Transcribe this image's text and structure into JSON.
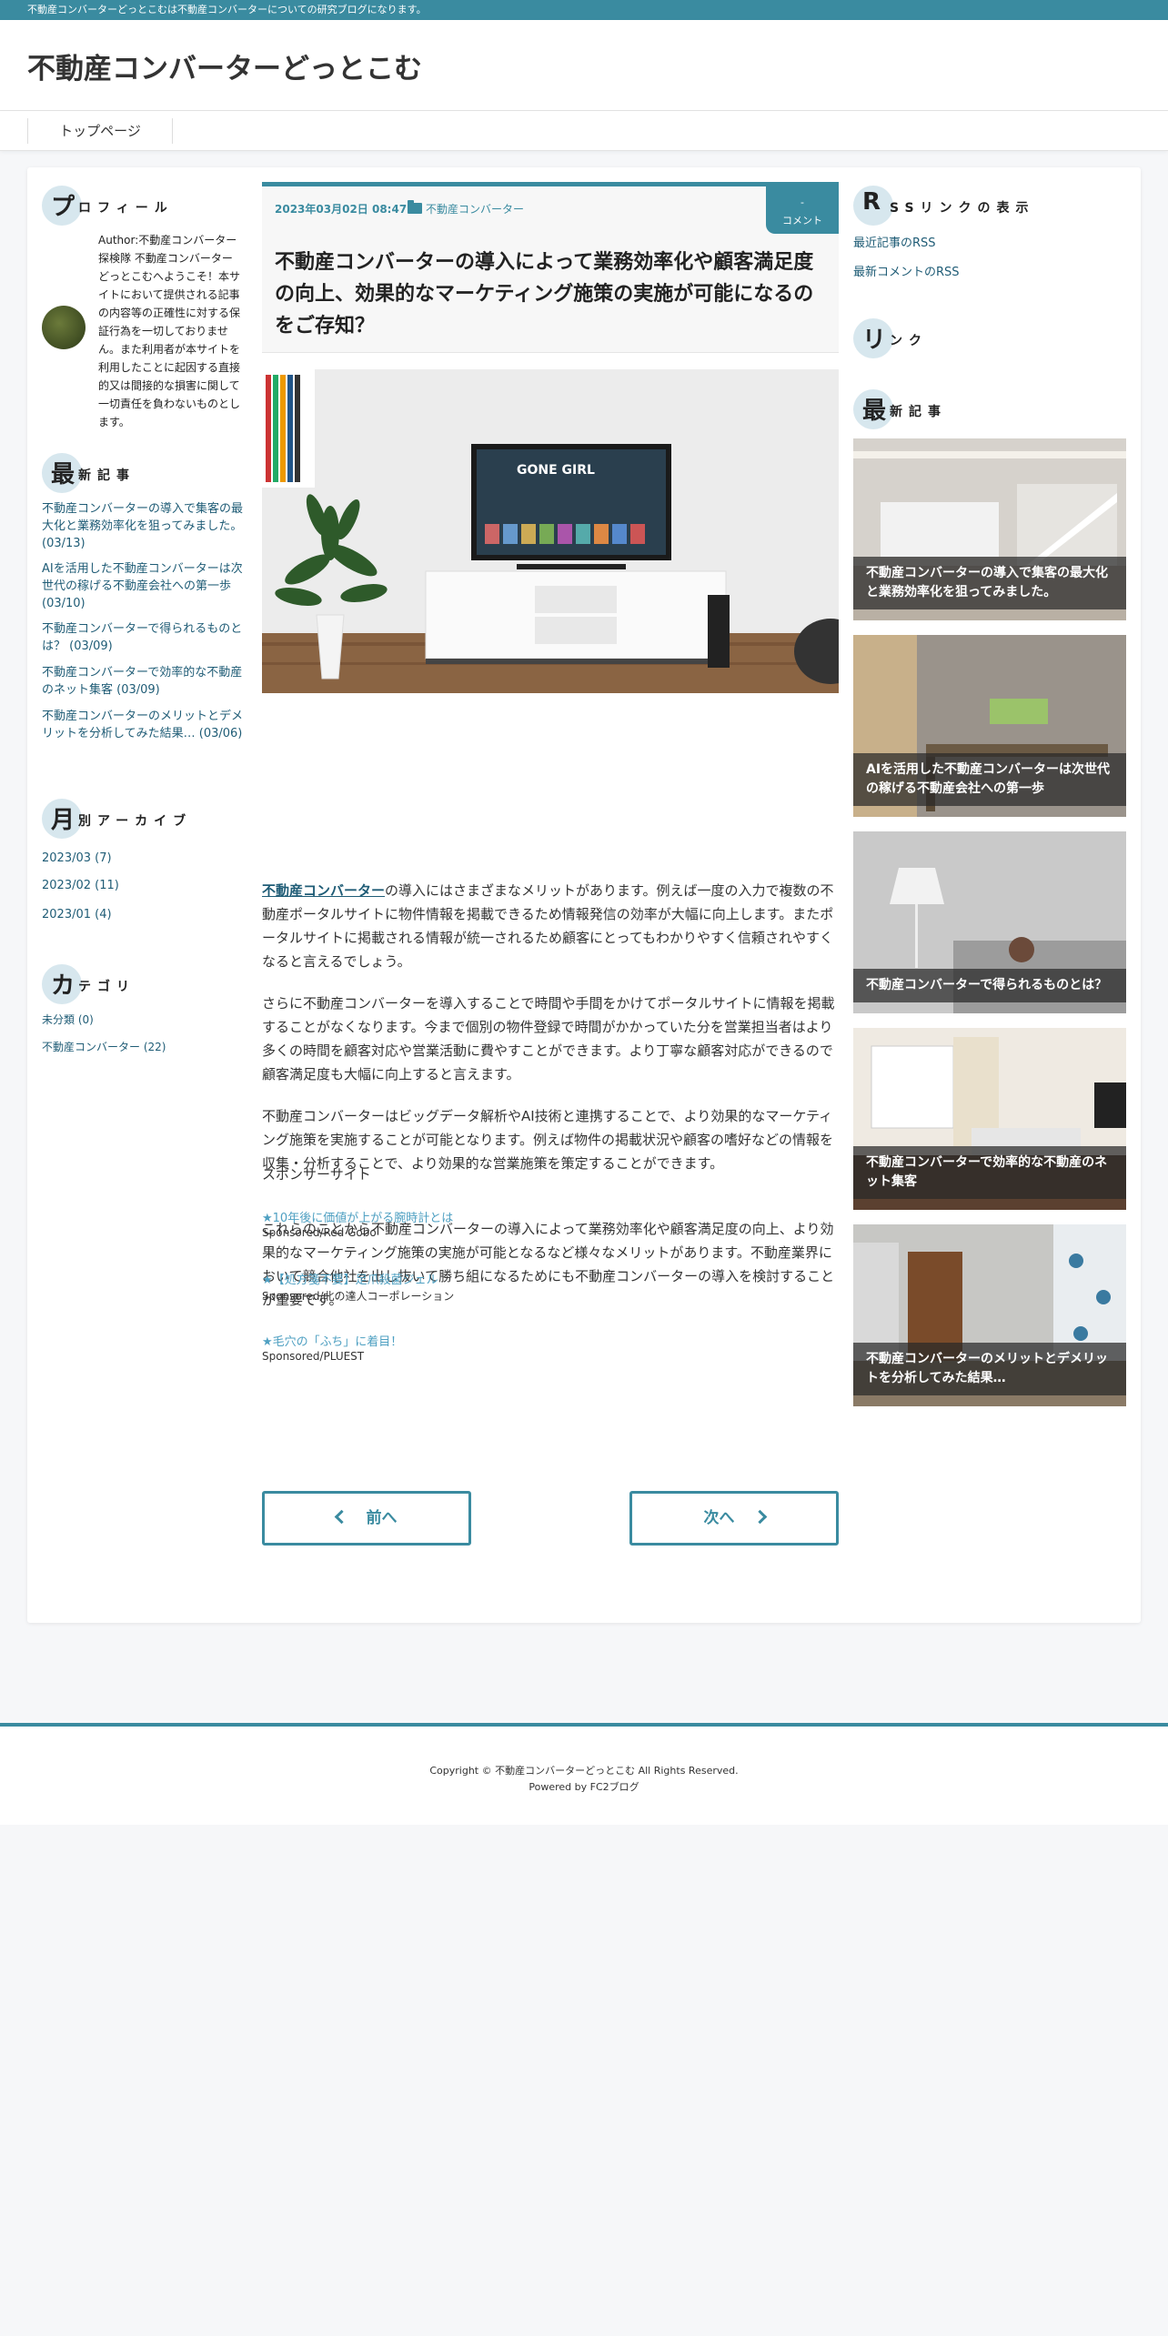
{
  "topbar": {
    "text": "不動産コンバーターどっとこむは不動産コンバーターについての研究ブログになります。"
  },
  "site": {
    "title": "不動産コンバーターどっとこむ"
  },
  "nav": {
    "items": [
      "トップページ"
    ]
  },
  "sidebar_left": {
    "profile": {
      "heading_big": "プ",
      "heading_rest": "ロフィール",
      "text": "Author:不動産コンバーター探検隊 不動産コンバーターどっとこむへようこそ！本サイトにおいて提供される記事の内容等の正確性に対する保証行為を一切しておりません。また利用者が本サイトを利用したことに起因する直接的又は間接的な損害に関して一切責任を負わないものとします。"
    },
    "recent": {
      "heading_big": "最",
      "heading_rest": "新記事",
      "items": [
        "不動産コンバーターの導入で集客の最大化と業務効率化を狙ってみました。 (03/13)",
        "AIを活用した不動産コンバーターは次世代の稼げる不動産会社への第一歩 (03/10)",
        "不動産コンバーターで得られるものとは？ (03/09)",
        "不動産コンバーターで効率的な不動産のネット集客 (03/09)",
        "不動産コンバーターのメリットとデメリットを分析してみた結果… (03/06)"
      ]
    },
    "archive": {
      "heading_big": "月",
      "heading_rest": "別アーカイブ",
      "items": [
        "2023/03 (7)",
        "2023/02 (11)",
        "2023/01 (4)"
      ]
    },
    "category": {
      "heading_big": "カ",
      "heading_rest": "テゴリ",
      "items": [
        "未分類 (0)",
        "不動産コンバーター (22)"
      ]
    }
  },
  "post": {
    "date": "2023年03月02日 08:47",
    "category": "不動産コンバーター",
    "comment_count": "-",
    "comment_label": "コメント",
    "title": "不動産コンバーターの導入によって業務効率化や顧客満足度の向上、効果的なマーケティング施策の実施が可能になるのをご存知？",
    "tv_title": "GONE GIRL",
    "p1_keyword": "不動産コンバーター",
    "p1": "の導入にはさまざまなメリットがあります。例えば一度の入力で複数の不動産ポータルサイトに物件情報を掲載できるため情報発信の効率が大幅に向上します。またポータルサイトに掲載される情報が統一されるため顧客にとってもわかりやすく信頼されやすくなると言えるでしょう。",
    "p2": "さらに不動産コンバーターを導入することで時間や手間をかけてポータルサイトに情報を掲載することがなくなります。今まで個別の物件登録で時間がかかっていた分を営業担当者はより多くの時間を顧客対応や営業活動に費やすことができます。より丁寧な顧客対応ができるので顧客満足度も大幅に向上すると言えます。",
    "p3": "不動産コンバーターはビッグデータ解析やAI技術と連携することで、より効果的なマーケティング施策を実施することが可能となります。例えば物件の掲載状況や顧客の嗜好などの情報を収集・分析することで、より効果的な営業施策を策定することができます。",
    "p4": "これらのことから不動産コンバーターの導入によって業務効率化や顧客満足度の向上、より効果的なマーケティング施策の実施が可能となるなど様々なメリットがあります。不動産業界において競合他社を出し抜いて勝ち組になるためにも不動産コンバーターの導入を検討することが重要です。",
    "sponsor_heading": "スポンサーサイト",
    "sponsors": [
      {
        "link": "★10年後に価値が上がる腕時計とは",
        "by": "Sponsored/Red Gobo"
      },
      {
        "link": "★【処方箋不要】足爪殺菌ジェル",
        "by": "Sponsored/北の達人コーポレーション"
      },
      {
        "link": "★毛穴の「ふち」に着目！",
        "by": "Sponsored/PLUEST"
      }
    ]
  },
  "pager": {
    "prev": "前へ",
    "next": "次へ"
  },
  "sidebar_right": {
    "rss": {
      "heading_big": "R",
      "heading_rest": "SSリンクの表示",
      "items": [
        "最近記事のRSS",
        "最新コメントのRSS"
      ]
    },
    "links": {
      "heading_big": "リ",
      "heading_rest": "ンク"
    },
    "recent": {
      "heading_big": "最",
      "heading_rest": "新記事",
      "items": [
        "不動産コンバーターの導入で集客の最大化と業務効率化を狙ってみました。",
        "AIを活用した不動産コンバーターは次世代の稼げる不動産会社への第一歩",
        "不動産コンバーターで得られるものとは？",
        "不動産コンバーターで効率的な不動産のネット集客",
        "不動産コンバーターのメリットとデメリットを分析してみた結果…"
      ]
    }
  },
  "footer": {
    "copyright": "Copyright © 不動産コンバーターどっとこむ All Rights Reserved.",
    "powered": "Powered by FC2ブログ"
  },
  "colors": {
    "accent": "#3a8ba0",
    "link": "#1f5c76",
    "sponsor_link": "#4fa0c2"
  }
}
